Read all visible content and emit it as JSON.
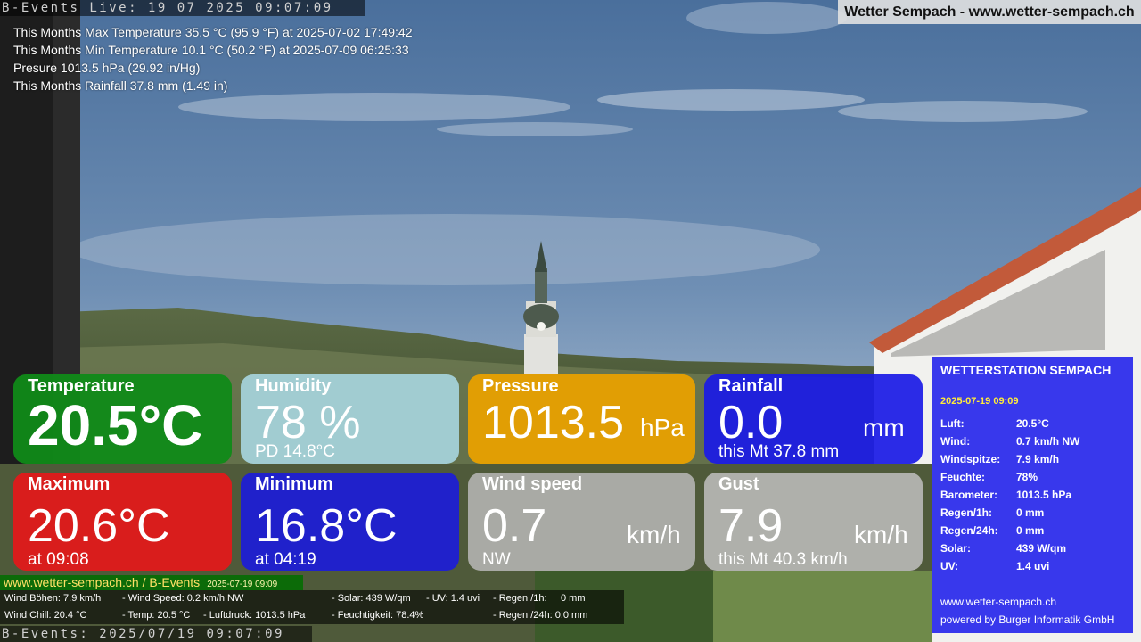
{
  "overlay": {
    "live_stamp": "B-Events Live: 19 07 2025 09:07:09",
    "bottom_stamp": "B-Events: 2025/07/19 09:07:09",
    "site_banner": "Wetter Sempach - www.wetter-sempach.ch"
  },
  "stats": [
    "This Months Max Temperature 35.5 °C (95.9 °F) at 2025-07-02 17:49:42",
    "This Months Min Temperature 10.1 °C (50.2 °F) at 2025-07-09 06:25:33",
    "Presure 1013.5 hPa (29.92 in/Hg)",
    "This Months Rainfall 37.8 mm (1.49 in)"
  ],
  "tiles": {
    "temperature": {
      "title": "Temperature",
      "value": "20.5°C"
    },
    "humidity": {
      "title": "Humidity",
      "value": "78 %",
      "sub": "PD 14.8°C"
    },
    "pressure": {
      "title": "Pressure",
      "value": "1013.5",
      "unit": "hPa"
    },
    "rainfall": {
      "title": "Rainfall",
      "value": "0.0",
      "unit": "mm",
      "sub": "this Mt 37.8 mm"
    },
    "maximum": {
      "title": "Maximum",
      "value": "20.6°C",
      "sub": "at 09:08"
    },
    "minimum": {
      "title": "Minimum",
      "value": "16.8°C",
      "sub": "at 04:19"
    },
    "wind_speed": {
      "title": "Wind speed",
      "value": "0.7",
      "unit": "km/h",
      "sub": "NW"
    },
    "gust": {
      "title": "Gust",
      "value": "7.9",
      "unit": "km/h",
      "sub": "this Mt 40.3 km/h"
    }
  },
  "ticker": {
    "site": "www.wetter-sempach.ch / B-Events",
    "datetime": "2025-07-19 09:09",
    "row1": [
      "Wind Böhen: 7.9 km/h",
      "- Wind Speed: 0.2 km/h NW",
      "- Solar: 439 W/qm",
      "- UV: 1.4 uvi",
      "- Regen /1h:",
      "0 mm"
    ],
    "row2": [
      "Wind Chill: 20.4 °C",
      "- Temp: 20.5 °C",
      "- Luftdruck: 1013.5 hPa",
      "- Feuchtigkeit: 78.4%",
      "- Regen /24h: 0.0 mm"
    ]
  },
  "station": {
    "title": "WETTERSTATION SEMPACH",
    "date": "2025-07-19 09:09",
    "rows": [
      {
        "k": "Luft:",
        "v": "20.5°C"
      },
      {
        "k": "Wind:",
        "v": "0.7 km/h  NW"
      },
      {
        "k": "Windspitze:",
        "v": "7.9 km/h"
      },
      {
        "k": "Feuchte:",
        "v": "78%"
      },
      {
        "k": "Barometer:",
        "v": "1013.5 hPa"
      },
      {
        "k": "Regen/1h:",
        "v": "0 mm"
      },
      {
        "k": "Regen/24h:",
        "v": "0 mm"
      },
      {
        "k": "Solar:",
        "v": "439 W/qm"
      },
      {
        "k": "UV:",
        "v": "1.4 uvi"
      }
    ],
    "footer_site": "www.wetter-sempach.ch",
    "footer_powered": "powered by Burger Informatik GmbH"
  },
  "colors": {
    "temperature": "#108a18",
    "humidity": "#a6d4dc",
    "pressure": "#e8a000",
    "rainfall": "#1a1ae6",
    "maximum": "#e01a1a",
    "minimum": "#1c1cd8",
    "wind_speed": "#b8b8b8",
    "gust": "#c0c0c0",
    "panel": "#2828eb"
  }
}
